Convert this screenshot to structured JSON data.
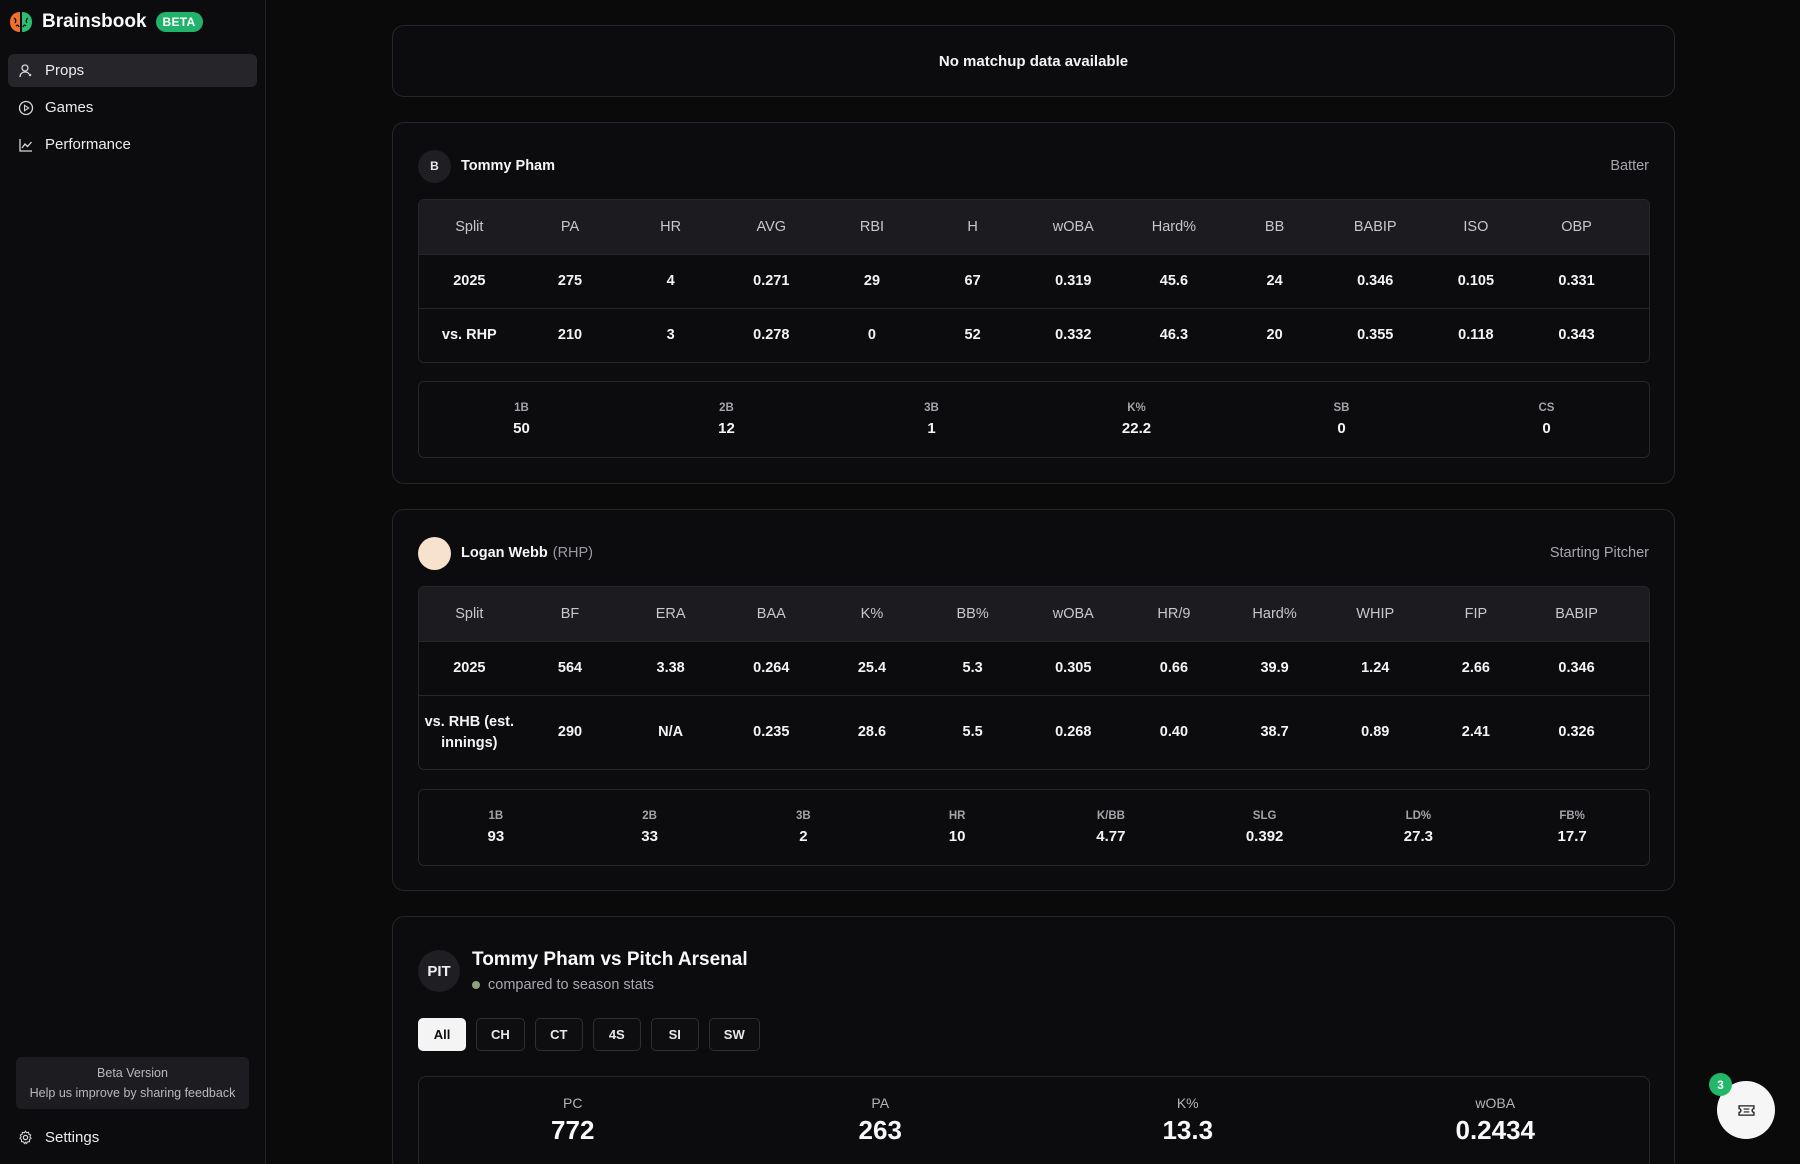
{
  "app": {
    "name": "Brainsbook",
    "badge": "BETA"
  },
  "sidebar": {
    "items": [
      {
        "label": "Props",
        "icon": "user-icon",
        "active": true
      },
      {
        "label": "Games",
        "icon": "play-circle-icon",
        "active": false
      },
      {
        "label": "Performance",
        "icon": "chart-line-icon",
        "active": false
      }
    ],
    "beta_title": "Beta Version",
    "beta_text": "Help us improve by sharing feedback",
    "settings_label": "Settings"
  },
  "matchup": {
    "empty_text": "No matchup data available"
  },
  "batter": {
    "avatar_letter": "B",
    "name": "Tommy Pham",
    "role": "Batter",
    "headers": [
      "Split",
      "PA",
      "HR",
      "AVG",
      "RBI",
      "H",
      "wOBA",
      "Hard%",
      "BB",
      "BABIP",
      "ISO",
      "OBP"
    ],
    "rows": [
      [
        "2025",
        "275",
        "4",
        "0.271",
        "29",
        "67",
        "0.319",
        "45.6",
        "24",
        "0.346",
        "0.105",
        "0.331"
      ],
      [
        "vs. RHP",
        "210",
        "3",
        "0.278",
        "0",
        "52",
        "0.332",
        "46.3",
        "20",
        "0.355",
        "0.118",
        "0.343"
      ]
    ],
    "extra": [
      {
        "label": "1B",
        "value": "50"
      },
      {
        "label": "2B",
        "value": "12"
      },
      {
        "label": "3B",
        "value": "1"
      },
      {
        "label": "K%",
        "value": "22.2"
      },
      {
        "label": "SB",
        "value": "0"
      },
      {
        "label": "CS",
        "value": "0"
      }
    ]
  },
  "pitcher": {
    "name": "Logan Webb",
    "hand": "(RHP)",
    "role": "Starting Pitcher",
    "headers": [
      "Split",
      "BF",
      "ERA",
      "BAA",
      "K%",
      "BB%",
      "wOBA",
      "HR/9",
      "Hard%",
      "WHIP",
      "FIP",
      "BABIP"
    ],
    "rows": [
      [
        "2025",
        "564",
        "3.38",
        "0.264",
        "25.4",
        "5.3",
        "0.305",
        "0.66",
        "39.9",
        "1.24",
        "2.66",
        "0.346"
      ],
      [
        "vs. RHB (est. innings)",
        "290",
        "N/A",
        "0.235",
        "28.6",
        "5.5",
        "0.268",
        "0.40",
        "38.7",
        "0.89",
        "2.41",
        "0.326"
      ]
    ],
    "extra": [
      {
        "label": "1B",
        "value": "93"
      },
      {
        "label": "2B",
        "value": "33"
      },
      {
        "label": "3B",
        "value": "2"
      },
      {
        "label": "HR",
        "value": "10"
      },
      {
        "label": "K/BB",
        "value": "4.77"
      },
      {
        "label": "SLG",
        "value": "0.392"
      },
      {
        "label": "LD%",
        "value": "27.3"
      },
      {
        "label": "FB%",
        "value": "17.7"
      }
    ]
  },
  "arsenal": {
    "avatar_text": "PIT",
    "title": "Tommy Pham vs Pitch Arsenal",
    "subtitle": "compared to season stats",
    "tabs": [
      "All",
      "CH",
      "CT",
      "4S",
      "SI",
      "SW"
    ],
    "active_tab": "All",
    "stats": [
      {
        "label": "PC",
        "value": "772"
      },
      {
        "label": "PA",
        "value": "263"
      },
      {
        "label": "K%",
        "value": "13.3"
      },
      {
        "label": "wOBA",
        "value": "0.2434"
      }
    ]
  },
  "fab": {
    "badge_count": "3",
    "icon": "ticket-icon"
  },
  "colors": {
    "accent_green": "#21b36b",
    "background": "#0a0a0b",
    "card_border": "#26262b"
  }
}
